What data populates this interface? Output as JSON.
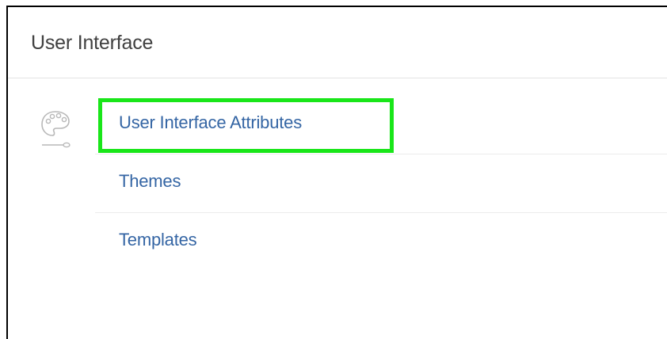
{
  "panel": {
    "title": "User Interface"
  },
  "icons": {
    "section_icon": "palette-icon"
  },
  "links": [
    {
      "label": "User Interface Attributes"
    },
    {
      "label": "Themes"
    },
    {
      "label": "Templates"
    }
  ],
  "colors": {
    "link": "#3465a4",
    "title": "#404040",
    "highlight": "#19e619"
  }
}
